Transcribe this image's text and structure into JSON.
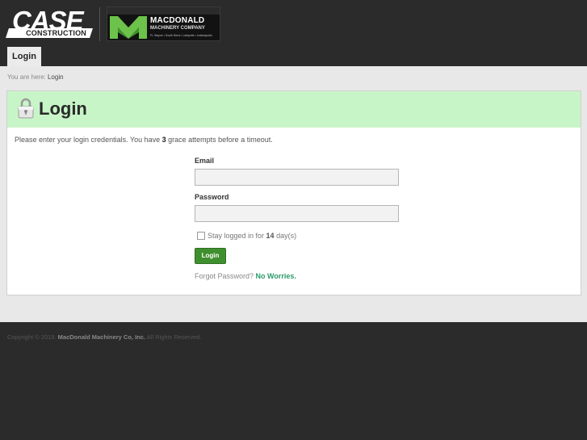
{
  "header": {
    "case_logo": {
      "word": "CASE",
      "sub": "CONSTRUCTION"
    },
    "mac_logo": {
      "title": "MACDONALD",
      "subtitle": "MACHINERY COMPANY",
      "cities": "Ft. Wayne • South Bend • Lafayette • Indianapolis"
    },
    "nav_tab": "Login"
  },
  "breadcrumb": {
    "prefix": "You are here:",
    "current": "Login"
  },
  "login": {
    "title": "Login",
    "intro_before": "Please enter your login credentials. You have ",
    "grace_attempts": "3",
    "intro_after": " grace attempts before a timeout.",
    "email_label": "Email",
    "email_value": "",
    "password_label": "Password",
    "password_value": "",
    "stay_before": "Stay logged in for ",
    "stay_days": "14",
    "stay_after": " day(s)",
    "stay_checked": false,
    "button_label": "Login",
    "forgot_text": "Forgot Password? ",
    "forgot_link": "No Worries."
  },
  "footer": {
    "before": "Copyright © 2019. ",
    "company": "MacDonald Machinery Co, Inc.",
    "after": " All Rights Reserved."
  },
  "colors": {
    "header_bg": "#2b2b2b",
    "panel_head_bg": "#c8f5c8",
    "button_bg": "#3f8f2f",
    "link": "#2a9a6a"
  }
}
